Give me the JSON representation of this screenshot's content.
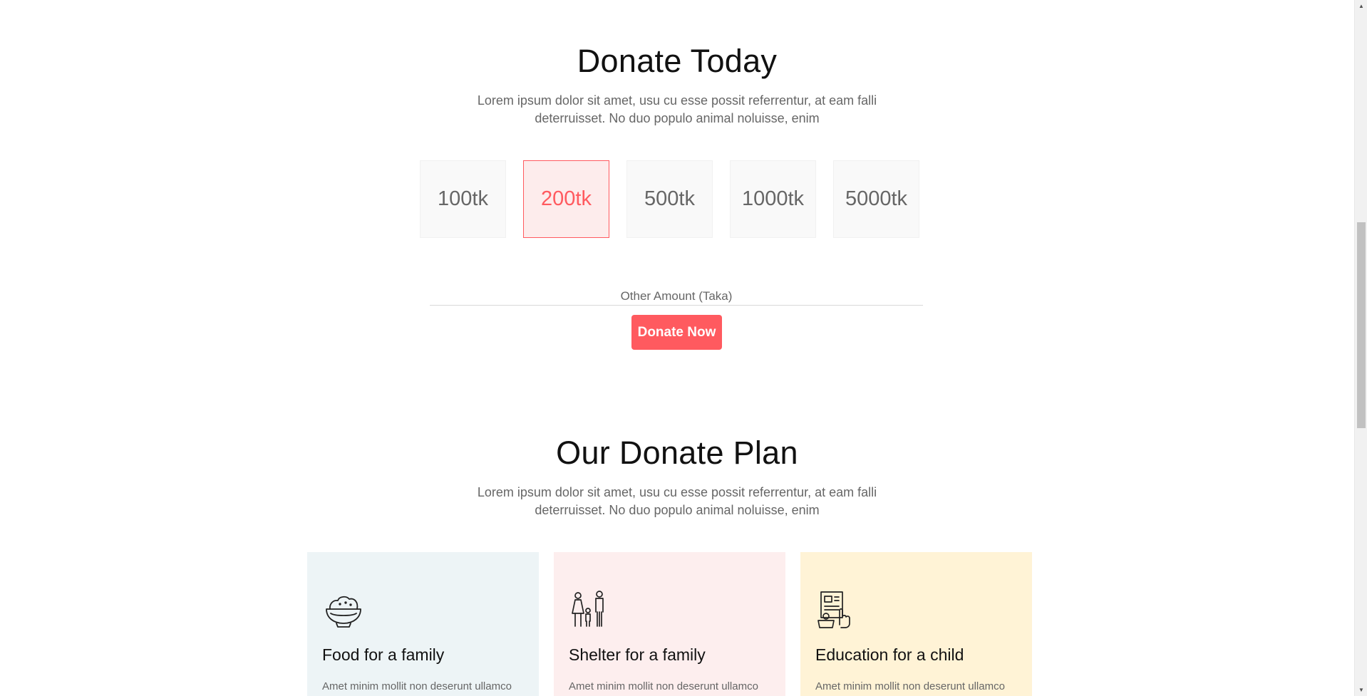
{
  "donate": {
    "title": "Donate Today",
    "description": "Lorem ipsum dolor sit amet, usu cu esse possit referrentur, at eam falli deterruisset. No duo populo animal noluisse, enim",
    "amounts": [
      "100tk",
      "200tk",
      "500tk",
      "1000tk",
      "5000tk"
    ],
    "selected_amount": "200tk",
    "other_amount_placeholder": "Other Amount (Taka)",
    "button_label": "Donate Now"
  },
  "plan": {
    "title": "Our Donate Plan",
    "description": "Lorem ipsum dolor sit amet, usu cu esse possit referrentur, at eam falli deterruisset. No duo populo animal noluisse, enim",
    "cards": [
      {
        "icon": "food-bowl-icon",
        "title": "Food for a family",
        "desc": "Amet minim mollit non deserunt ullamco",
        "bg": "#edf4f6"
      },
      {
        "icon": "family-icon",
        "title": "Shelter for a family",
        "desc": "Amet minim mollit non deserunt ullamco",
        "bg": "#fdeeee"
      },
      {
        "icon": "education-icon",
        "title": "Education for a child",
        "desc": "Amet minim mollit non deserunt ullamco",
        "bg": "#fff3d6"
      }
    ]
  },
  "colors": {
    "accent": "#ff5a5f",
    "accent_light": "#fdecec",
    "text_muted": "#666666"
  }
}
